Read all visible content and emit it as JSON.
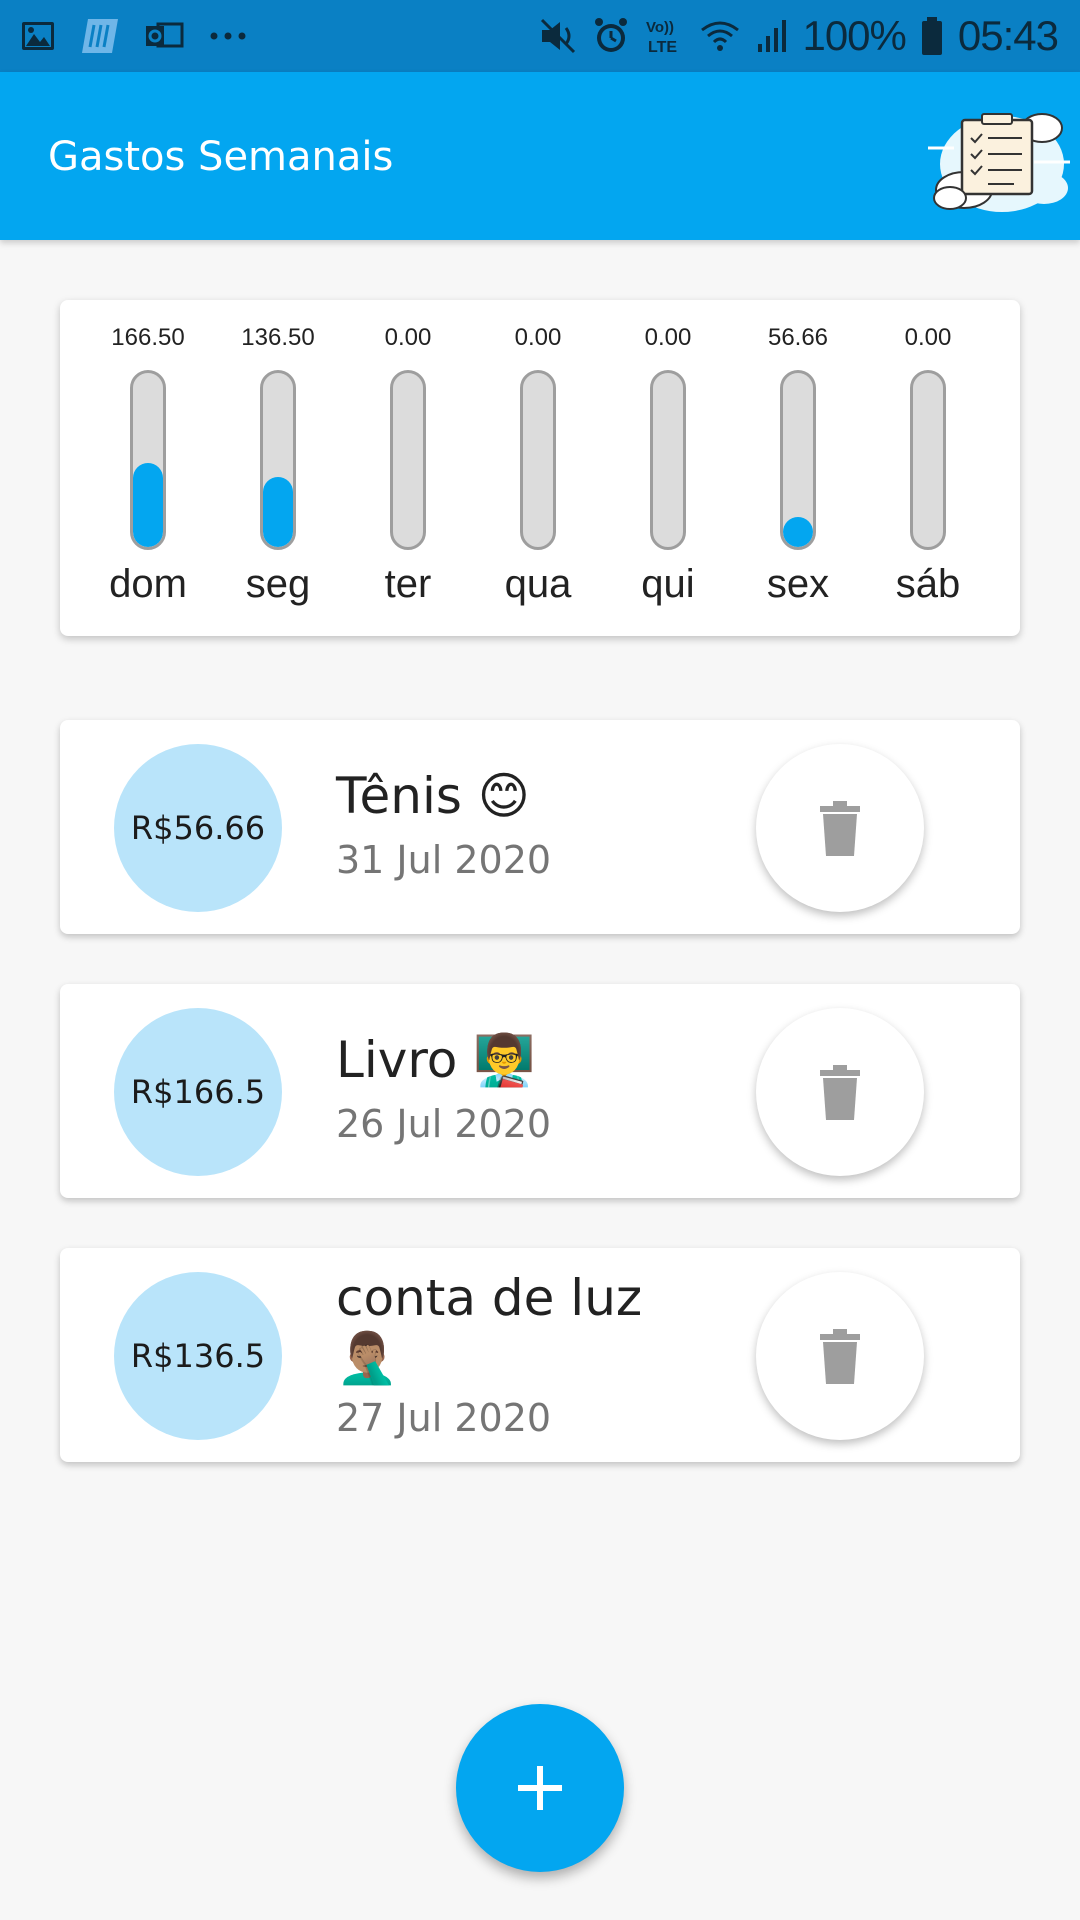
{
  "status_bar": {
    "battery": "100%",
    "time": "05:43",
    "icons": [
      "gallery-icon",
      "app-icon",
      "outlook-icon",
      "more-icon",
      "mute-icon",
      "alarm-icon",
      "volte-icon",
      "wifi-icon",
      "signal-icon",
      "battery-icon"
    ]
  },
  "app_bar": {
    "title": "Gastos Semanais",
    "logo_icon": "checklist-cloud-icon"
  },
  "chart": {
    "days": [
      {
        "label": "dom",
        "value": "166.50",
        "fill": 0.48
      },
      {
        "label": "seg",
        "value": "136.50",
        "fill": 0.4
      },
      {
        "label": "ter",
        "value": "0.00",
        "fill": 0
      },
      {
        "label": "qua",
        "value": "0.00",
        "fill": 0
      },
      {
        "label": "qui",
        "value": "0.00",
        "fill": 0
      },
      {
        "label": "sex",
        "value": "56.66",
        "fill": 0.17
      },
      {
        "label": "sáb",
        "value": "0.00",
        "fill": 0
      }
    ]
  },
  "transactions": [
    {
      "amount": "R$56.66",
      "title": "Tênis 😊",
      "date": "31 Jul 2020"
    },
    {
      "amount": "R$166.5",
      "title": "Livro 👨‍🏫",
      "date": "26 Jul 2020"
    },
    {
      "amount": "R$136.5",
      "title": "conta de luz 🤦🏽‍♂️",
      "date": "27 Jul 2020"
    }
  ],
  "fab": {
    "icon": "add-icon"
  },
  "colors": {
    "primary": "#03a6f0",
    "status_bar": "#0a80c4",
    "amount_circle": "#b9e4fa",
    "track": "#dcdcdc",
    "delete_icon": "#9e9e9e"
  }
}
